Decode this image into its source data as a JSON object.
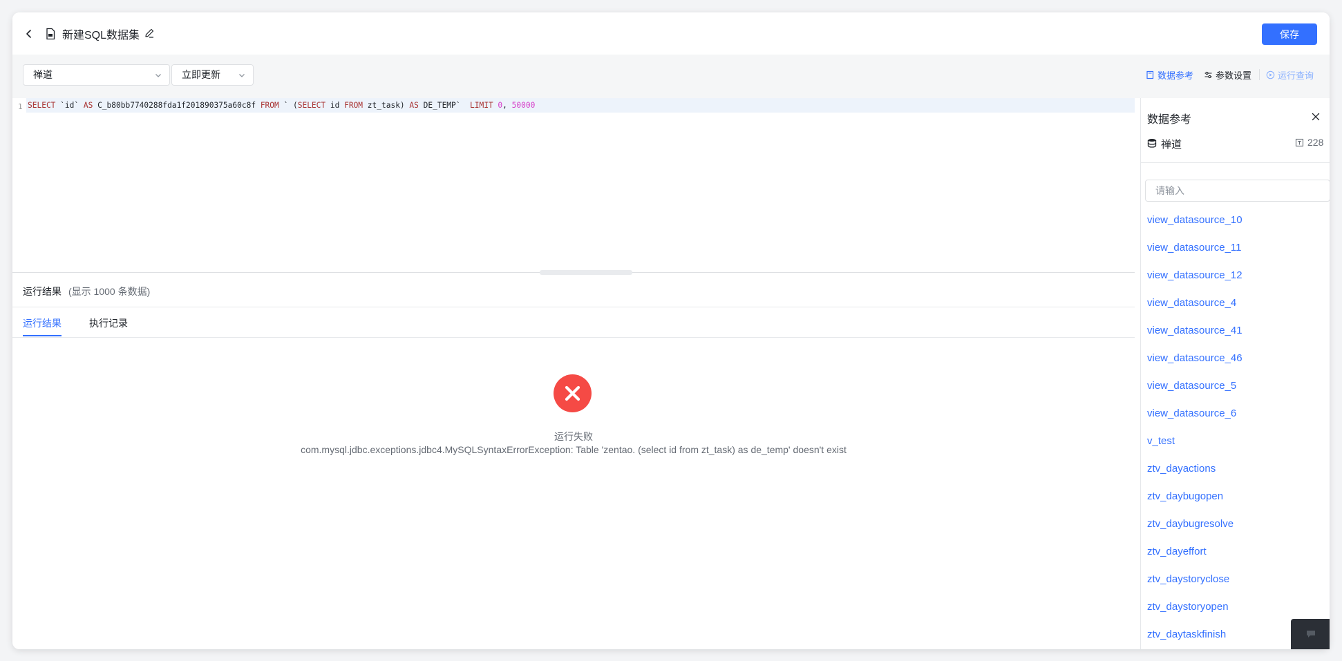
{
  "header": {
    "title": "新建SQL数据集",
    "save_label": "保存"
  },
  "toolbar": {
    "datasource_value": "禅道",
    "update_value": "立即更新",
    "data_reference_label": "数据参考",
    "param_settings_label": "参数设置",
    "run_query_label": "运行查询"
  },
  "editor": {
    "line_number": "1",
    "tokens": [
      {
        "cls": "kw",
        "text": "SELECT "
      },
      {
        "cls": "ident",
        "text": "`id` "
      },
      {
        "cls": "kw",
        "text": "AS "
      },
      {
        "cls": "ident",
        "text": "C_b80bb7740288fda1f201890375a60c8f "
      },
      {
        "cls": "kw",
        "text": "FROM "
      },
      {
        "cls": "ident",
        "text": "` ("
      },
      {
        "cls": "kw",
        "text": "SELECT "
      },
      {
        "cls": "ident",
        "text": "id "
      },
      {
        "cls": "kw",
        "text": "FROM "
      },
      {
        "cls": "ident",
        "text": "zt_task) "
      },
      {
        "cls": "kw",
        "text": "AS "
      },
      {
        "cls": "ident",
        "text": "DE_TEMP`  "
      },
      {
        "cls": "kw",
        "text": "LIMIT "
      },
      {
        "cls": "num",
        "text": "0"
      },
      {
        "cls": "ident",
        "text": ", "
      },
      {
        "cls": "num",
        "text": "50000"
      }
    ]
  },
  "result": {
    "title": "运行结果",
    "count_text": "(显示 1000 条数据)",
    "tabs": [
      "运行结果",
      "执行记录"
    ],
    "error_title": "运行失败",
    "error_message": "com.mysql.jdbc.exceptions.jdbc4.MySQLSyntaxErrorException: Table 'zentao. (select id from zt_task) as de_temp' doesn't exist"
  },
  "side_panel": {
    "title": "数据参考",
    "datasource_name": "禅道",
    "table_count": "228",
    "search_placeholder": "请输入",
    "tables": [
      "view_datasource_10",
      "view_datasource_11",
      "view_datasource_12",
      "view_datasource_4",
      "view_datasource_41",
      "view_datasource_46",
      "view_datasource_5",
      "view_datasource_6",
      "v_test",
      "ztv_dayactions",
      "ztv_daybugopen",
      "ztv_daybugresolve",
      "ztv_dayeffort",
      "ztv_daystoryclose",
      "ztv_daystoryopen",
      "ztv_daytaskfinish"
    ]
  },
  "colors": {
    "primary": "#3370ff",
    "error": "#f54a45",
    "keyword": "#a83232",
    "number": "#d63ec9"
  },
  "icons": {
    "back": "chevron-left-icon",
    "file": "sql-file-icon",
    "edit": "pencil-icon",
    "data_reference": "book-icon",
    "params": "sliders-icon",
    "run": "play-circle-icon",
    "close": "close-icon",
    "database": "database-icon",
    "table_count": "table-icon",
    "error": "error-circle-icon"
  }
}
